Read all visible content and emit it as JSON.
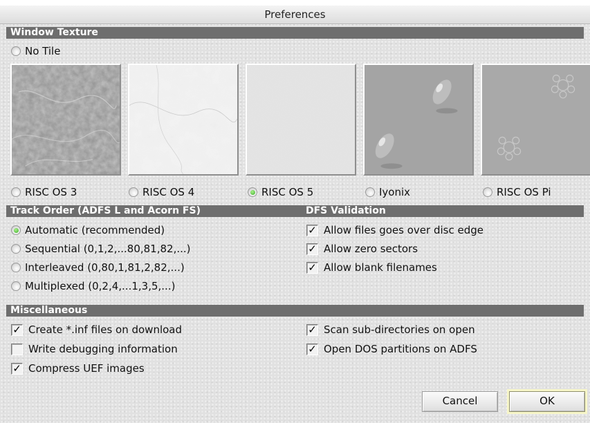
{
  "window": {
    "title": "Preferences"
  },
  "sections": {
    "window_texture": "Window Texture",
    "track_order": "Track Order (ADFS L and Acorn FS)",
    "dfs_validation": "DFS Validation",
    "miscellaneous": "Miscellaneous"
  },
  "texture": {
    "no_tile": {
      "label": "No Tile",
      "selected": false
    },
    "tiles": [
      {
        "label": "RISC OS 3",
        "selected": false
      },
      {
        "label": "RISC OS 4",
        "selected": false
      },
      {
        "label": "RISC OS 5",
        "selected": true
      },
      {
        "label": "Iyonix",
        "selected": false
      },
      {
        "label": "RISC OS Pi",
        "selected": false
      }
    ]
  },
  "track_order": [
    {
      "label": "Automatic (recommended)",
      "selected": true
    },
    {
      "label": "Sequential (0,1,2,...80,81,82,...)",
      "selected": false
    },
    {
      "label": "Interleaved (0,80,1,81,2,82,...)",
      "selected": false
    },
    {
      "label": "Multiplexed (0,2,4,...1,3,5,...)",
      "selected": false
    }
  ],
  "dfs_validation": [
    {
      "label": "Allow files goes over disc edge",
      "checked": true
    },
    {
      "label": "Allow zero sectors",
      "checked": true
    },
    {
      "label": "Allow blank filenames",
      "checked": true
    }
  ],
  "misc_left": [
    {
      "label": "Create *.inf files on download",
      "checked": true
    },
    {
      "label": "Write debugging information",
      "checked": false
    },
    {
      "label": "Compress UEF images",
      "checked": true
    }
  ],
  "misc_right": [
    {
      "label": "Scan sub-directories on open",
      "checked": true
    },
    {
      "label": "Open DOS partitions on ADFS",
      "checked": true
    }
  ],
  "buttons": {
    "cancel": "Cancel",
    "ok": "OK"
  },
  "colors": {
    "section_bar": "#6e6e6e",
    "radio_selected": "#3fae2c",
    "ok_highlight": "#f7f6c9"
  }
}
